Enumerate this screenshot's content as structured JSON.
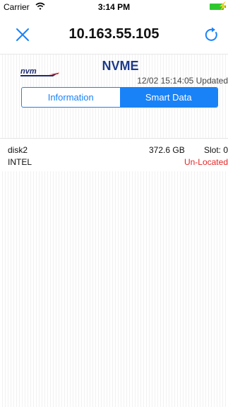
{
  "status_bar": {
    "carrier": "Carrier",
    "time": "3:14 PM"
  },
  "nav": {
    "title": "10.163.55.105"
  },
  "device": {
    "logo_text": "nvm",
    "name": "NVME",
    "updated": "12/02 15:14:05 Updated"
  },
  "tabs": [
    {
      "label": "Information",
      "selected": false
    },
    {
      "label": "Smart Data",
      "selected": true
    }
  ],
  "disk": {
    "name": "disk2",
    "size": "372.6 GB",
    "slot": "Slot: 0",
    "vendor": "INTEL",
    "location": "Un-Located"
  },
  "colors": {
    "accent": "#1a82f7",
    "warning": "#e52525",
    "battery": "#2ec82e"
  }
}
